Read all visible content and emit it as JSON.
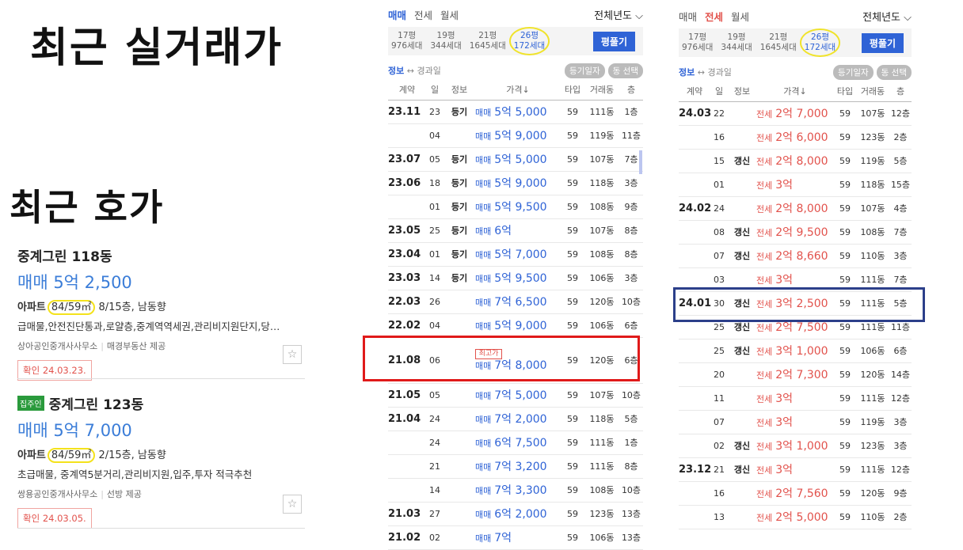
{
  "headings": {
    "recent_real": "최근 실거래가",
    "recent_ask": "최근 호가"
  },
  "listings": [
    {
      "badge": "",
      "title": "중계그린 118동",
      "price": "매매 5억 2,500",
      "spec_prefix": "아파트",
      "area": "84/59㎡",
      "spec_rest": " 8/15층, 남동향",
      "desc": "급매물,안전진단통과,로얄층,중계역역세권,관리비지원단지,당…",
      "agent": "상아공인중개사사무소",
      "provider": "매경부동산 제공",
      "confirm": "확인 24.03.23."
    },
    {
      "badge": "집주인",
      "title": "중계그린 123동",
      "price": "매매 5억 7,000",
      "spec_prefix": "아파트",
      "area": "84/59㎡",
      "spec_rest": " 2/15층, 남동향",
      "desc": "초급매물, 중계역5분거리,관리비지원,입주,투자 적극추천",
      "agent": "쌍용공인중개사사무소",
      "provider": "선방 제공",
      "confirm": "확인 24.03.05."
    }
  ],
  "colors": {
    "accent_blue": "#2f63d6",
    "rent_red": "#e2524c",
    "highlight_yellow": "#f0e32a",
    "box_red": "#e01a1a",
    "box_navy": "#2c3f8a"
  },
  "icons": {
    "favorite": "star-icon",
    "sort": "arrow-down-icon",
    "dropdown": "chevron-down-icon"
  },
  "sale_panel": {
    "tabs": [
      "매매",
      "전세",
      "월세"
    ],
    "active_tab": "매매",
    "year_select": "전체년도 ⌵",
    "sizes": [
      {
        "py": "17평",
        "hh": "976세대"
      },
      {
        "py": "19평",
        "hh": "344세대"
      },
      {
        "py": "21평",
        "hh": "1645세대"
      },
      {
        "py": "26평",
        "hh": "172세대"
      }
    ],
    "pyeong_button": "평풀기",
    "info_label": "정보",
    "swap_label": "↔ 경과일",
    "pill1": "등기일자",
    "pill2": "동 선택",
    "headers": [
      "계약",
      "일",
      "정보",
      "가격↓",
      "타입",
      "거래동",
      "층"
    ],
    "rows": [
      {
        "ym": "23.11",
        "d": "23",
        "info": "등기",
        "ty": "매매",
        "p": "5억 5,000",
        "t": "59",
        "dong": "111동",
        "fl": "1층",
        "tag": ""
      },
      {
        "ym": "",
        "d": "04",
        "info": "",
        "ty": "매매",
        "p": "5억 9,000",
        "t": "59",
        "dong": "119동",
        "fl": "11층",
        "tag": ""
      },
      {
        "ym": "23.07",
        "d": "05",
        "info": "등기",
        "ty": "매매",
        "p": "5억 5,000",
        "t": "59",
        "dong": "107동",
        "fl": "7층",
        "tag": ""
      },
      {
        "ym": "23.06",
        "d": "18",
        "info": "등기",
        "ty": "매매",
        "p": "5억 9,000",
        "t": "59",
        "dong": "118동",
        "fl": "3층",
        "tag": ""
      },
      {
        "ym": "",
        "d": "01",
        "info": "등기",
        "ty": "매매",
        "p": "5억 9,500",
        "t": "59",
        "dong": "108동",
        "fl": "9층",
        "tag": ""
      },
      {
        "ym": "23.05",
        "d": "25",
        "info": "등기",
        "ty": "매매",
        "p": "6억",
        "t": "59",
        "dong": "107동",
        "fl": "8층",
        "tag": ""
      },
      {
        "ym": "23.04",
        "d": "01",
        "info": "등기",
        "ty": "매매",
        "p": "5억 7,000",
        "t": "59",
        "dong": "108동",
        "fl": "8층",
        "tag": ""
      },
      {
        "ym": "23.03",
        "d": "14",
        "info": "등기",
        "ty": "매매",
        "p": "5억 9,500",
        "t": "59",
        "dong": "106동",
        "fl": "3층",
        "tag": ""
      },
      {
        "ym": "22.03",
        "d": "26",
        "info": "",
        "ty": "매매",
        "p": "7억 6,500",
        "t": "59",
        "dong": "120동",
        "fl": "10층",
        "tag": ""
      },
      {
        "ym": "22.02",
        "d": "04",
        "info": "",
        "ty": "매매",
        "p": "5억 9,000",
        "t": "59",
        "dong": "106동",
        "fl": "6층",
        "tag": ""
      },
      {
        "ym": "21.08",
        "d": "06",
        "info": "",
        "ty": "매매",
        "p": "7억 8,000",
        "t": "59",
        "dong": "120동",
        "fl": "6층",
        "tag": "최고가"
      },
      {
        "ym": "21.05",
        "d": "05",
        "info": "",
        "ty": "매매",
        "p": "7억 5,000",
        "t": "59",
        "dong": "107동",
        "fl": "10층",
        "tag": ""
      },
      {
        "ym": "21.04",
        "d": "24",
        "info": "",
        "ty": "매매",
        "p": "7억 2,000",
        "t": "59",
        "dong": "118동",
        "fl": "5층",
        "tag": ""
      },
      {
        "ym": "",
        "d": "24",
        "info": "",
        "ty": "매매",
        "p": "6억 7,500",
        "t": "59",
        "dong": "111동",
        "fl": "1층",
        "tag": ""
      },
      {
        "ym": "",
        "d": "21",
        "info": "",
        "ty": "매매",
        "p": "7억 3,200",
        "t": "59",
        "dong": "111동",
        "fl": "8층",
        "tag": ""
      },
      {
        "ym": "",
        "d": "14",
        "info": "",
        "ty": "매매",
        "p": "7억 3,300",
        "t": "59",
        "dong": "108동",
        "fl": "10층",
        "tag": ""
      },
      {
        "ym": "21.03",
        "d": "27",
        "info": "",
        "ty": "매매",
        "p": "6억 2,000",
        "t": "59",
        "dong": "123동",
        "fl": "13층",
        "tag": ""
      },
      {
        "ym": "21.02",
        "d": "02",
        "info": "",
        "ty": "매매",
        "p": "7억",
        "t": "59",
        "dong": "106동",
        "fl": "13층",
        "tag": ""
      }
    ]
  },
  "rent_panel": {
    "tabs": [
      "매매",
      "전세",
      "월세"
    ],
    "active_tab": "전세",
    "year_select": "전체년도 ⌵",
    "sizes": [
      {
        "py": "17평",
        "hh": "976세대"
      },
      {
        "py": "19평",
        "hh": "344세대"
      },
      {
        "py": "21평",
        "hh": "1645세대"
      },
      {
        "py": "26평",
        "hh": "172세대"
      }
    ],
    "pyeong_button": "평풀기",
    "info_label": "정보",
    "swap_label": "↔ 경과일",
    "pill1": "등기일자",
    "pill2": "동 선택",
    "headers": [
      "계약",
      "일",
      "정보",
      "가격↓",
      "타입",
      "거래동",
      "층"
    ],
    "rows": [
      {
        "ym": "24.03",
        "d": "22",
        "info": "",
        "ty": "전세",
        "p": "2억 7,000",
        "t": "59",
        "dong": "107동",
        "fl": "12층"
      },
      {
        "ym": "",
        "d": "16",
        "info": "",
        "ty": "전세",
        "p": "2억 6,000",
        "t": "59",
        "dong": "123동",
        "fl": "2층"
      },
      {
        "ym": "",
        "d": "15",
        "info": "갱신",
        "ty": "전세",
        "p": "2억 8,000",
        "t": "59",
        "dong": "119동",
        "fl": "5층"
      },
      {
        "ym": "",
        "d": "01",
        "info": "",
        "ty": "전세",
        "p": "3억",
        "t": "59",
        "dong": "118동",
        "fl": "15층"
      },
      {
        "ym": "24.02",
        "d": "24",
        "info": "",
        "ty": "전세",
        "p": "2억 8,000",
        "t": "59",
        "dong": "107동",
        "fl": "4층"
      },
      {
        "ym": "",
        "d": "08",
        "info": "갱신",
        "ty": "전세",
        "p": "2억 9,500",
        "t": "59",
        "dong": "108동",
        "fl": "7층"
      },
      {
        "ym": "",
        "d": "07",
        "info": "갱신",
        "ty": "전세",
        "p": "2억 8,660",
        "t": "59",
        "dong": "110동",
        "fl": "3층"
      },
      {
        "ym": "",
        "d": "03",
        "info": "",
        "ty": "전세",
        "p": "3억",
        "t": "59",
        "dong": "111동",
        "fl": "7층"
      },
      {
        "ym": "24.01",
        "d": "30",
        "info": "갱신",
        "ty": "전세",
        "p": "3억 2,500",
        "t": "59",
        "dong": "111동",
        "fl": "5층"
      },
      {
        "ym": "",
        "d": "25",
        "info": "갱신",
        "ty": "전세",
        "p": "2억 7,500",
        "t": "59",
        "dong": "111동",
        "fl": "11층"
      },
      {
        "ym": "",
        "d": "25",
        "info": "갱신",
        "ty": "전세",
        "p": "3억 1,000",
        "t": "59",
        "dong": "106동",
        "fl": "6층"
      },
      {
        "ym": "",
        "d": "20",
        "info": "",
        "ty": "전세",
        "p": "2억 7,300",
        "t": "59",
        "dong": "120동",
        "fl": "14층"
      },
      {
        "ym": "",
        "d": "11",
        "info": "",
        "ty": "전세",
        "p": "3억",
        "t": "59",
        "dong": "111동",
        "fl": "12층"
      },
      {
        "ym": "",
        "d": "07",
        "info": "",
        "ty": "전세",
        "p": "3억",
        "t": "59",
        "dong": "119동",
        "fl": "3층"
      },
      {
        "ym": "",
        "d": "02",
        "info": "갱신",
        "ty": "전세",
        "p": "3억 1,000",
        "t": "59",
        "dong": "123동",
        "fl": "3층"
      },
      {
        "ym": "23.12",
        "d": "21",
        "info": "갱신",
        "ty": "전세",
        "p": "3억",
        "t": "59",
        "dong": "111동",
        "fl": "12층"
      },
      {
        "ym": "",
        "d": "16",
        "info": "",
        "ty": "전세",
        "p": "2억 7,560",
        "t": "59",
        "dong": "120동",
        "fl": "9층"
      },
      {
        "ym": "",
        "d": "13",
        "info": "",
        "ty": "전세",
        "p": "2억 5,000",
        "t": "59",
        "dong": "110동",
        "fl": "2층"
      }
    ]
  }
}
